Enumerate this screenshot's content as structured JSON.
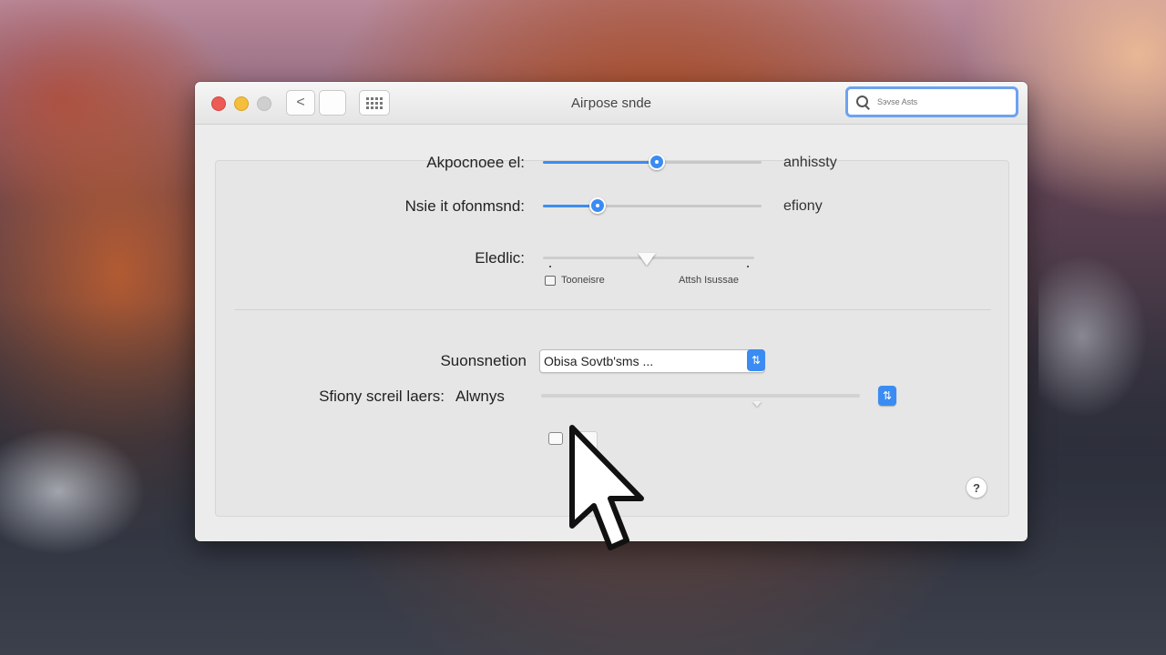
{
  "window": {
    "title": "Aiгрose snde"
  },
  "toolbar": {
    "back_glyph": "<",
    "forward_glyph": "",
    "grid_icon": "grid-icon"
  },
  "search": {
    "icon": "search-icon",
    "placeholder": "Sэvse Asts"
  },
  "settings": {
    "row1": {
      "label": "Akpocnoee el:",
      "value_text": "anhissty",
      "level": 0.52
    },
    "row2": {
      "label": "Nsie it ofonmsnd:",
      "value_text": "efiony",
      "level": 0.25
    },
    "row3": {
      "label": "Eledlic:",
      "level": 0.49,
      "left_label": "Tooneisre",
      "right_label": "Attsh Isussae"
    },
    "dropdown": {
      "label": "Suonsnetion",
      "value": "Obisa Sovtb'sms ..."
    },
    "scroll": {
      "label": "Sfiony screil laers:",
      "value_text": "Alwnys"
    }
  },
  "help": {
    "glyph": "?"
  },
  "colors": {
    "accent": "#3b8cf2",
    "close": "#ec5b55",
    "minimize": "#f4bf3a",
    "zoom": "#cfcfcf"
  }
}
